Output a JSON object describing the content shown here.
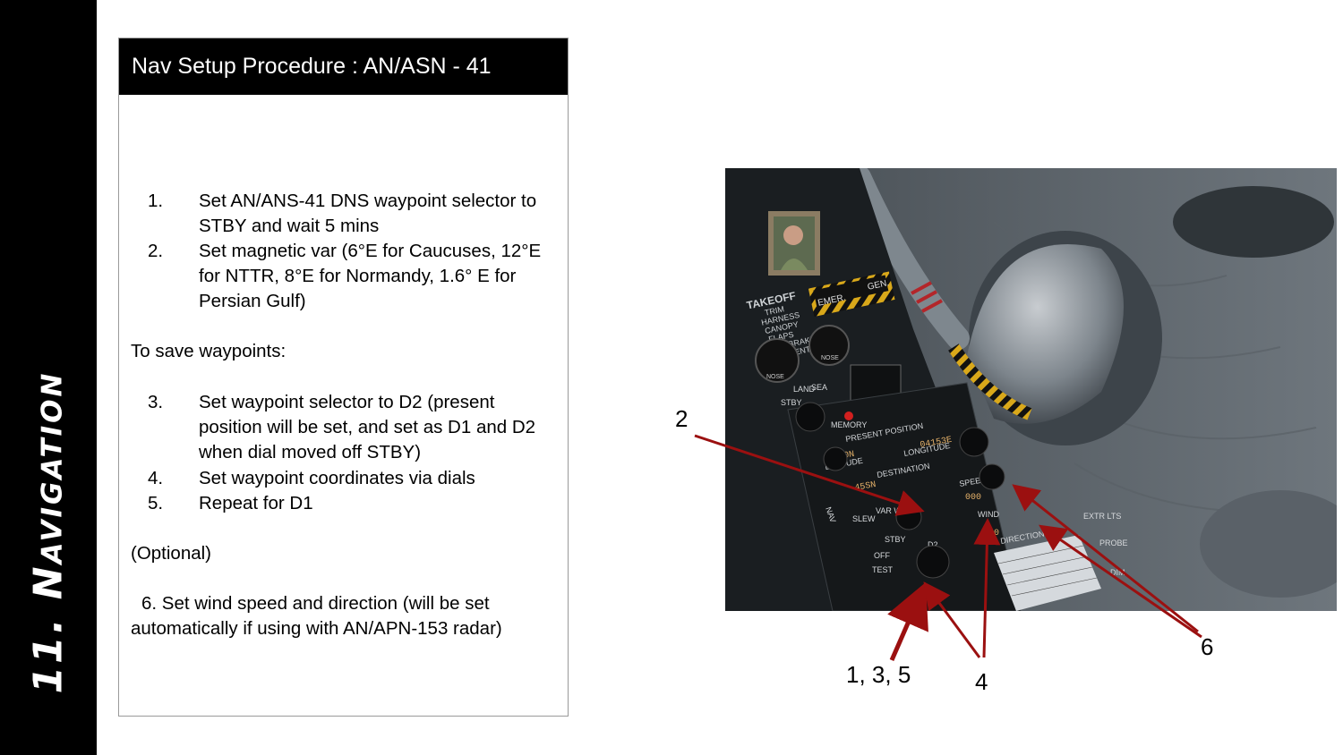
{
  "sidebar": {
    "title": "11. Navigation"
  },
  "card": {
    "header": "Nav Setup Procedure : AN/ASN - 41",
    "steps_a": [
      {
        "num": "1.",
        "text": "Set AN/ANS-41 DNS waypoint selector to STBY and wait 5 mins"
      },
      {
        "num": "2.",
        "text": "Set magnetic var (6°E for Caucuses, 12°E for NTTR, 8°E for Normandy, 1.6° E for Persian Gulf)"
      }
    ],
    "save_heading": "To save waypoints:",
    "steps_b": [
      {
        "num": "3.",
        "text": "Set waypoint selector to D2 (present position will be set, and set as D1 and D2 when dial moved off STBY)"
      },
      {
        "num": "4.",
        "text": "Set waypoint coordinates via dials"
      },
      {
        "num": "5.",
        "text": "Repeat for D1"
      }
    ],
    "optional": "(Optional)",
    "step6": "6. Set wind speed and direction (will be set automatically if using with AN/APN-153 radar)"
  },
  "photo": {
    "placard": [
      "TAKEOFF",
      "TRIM",
      "HARNESS",
      "CANOPY",
      "FLAPS",
      "SPEEDBRAKE",
      "ARMAMENT"
    ],
    "emer": "EMER.",
    "gen": "GEN.",
    "present_position": "PRESENT POSITION",
    "latitude": "LATITUDE",
    "longitude": "LONGITUDE",
    "destination": "DESTINATION",
    "speed": "SPEED",
    "wind": "WIND",
    "direction": "DIRECTION",
    "slew": "SLEW",
    "mag_var": "VAR W",
    "stby": "STBY",
    "d2": "D2",
    "off": "OFF",
    "test": "TEST",
    "nav": "NAV",
    "memory": "MEMORY",
    "nose": "NOSE",
    "stby_left": "STBY",
    "land": "LAND",
    "sea": "SEA",
    "extr_lts": "EXTR LTS",
    "probe": "PROBE",
    "dim": "DIM",
    "lat_digits": "0040N",
    "lon_digits": "04153E",
    "dest_lat_digits": "45SN",
    "speed_digits": "000",
    "dir_digits": "000"
  },
  "callouts": {
    "c2": "2",
    "c135": "1, 3, 5",
    "c4": "4",
    "c6": "6"
  },
  "colors": {
    "arrow": "#9b1010",
    "sidebar": "#000000",
    "header": "#000000"
  }
}
